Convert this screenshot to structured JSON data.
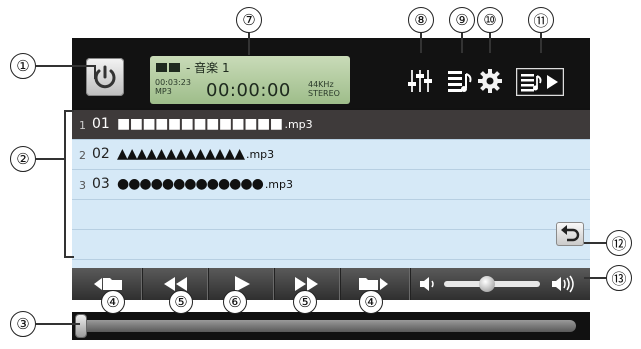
{
  "lcd": {
    "track_title": "- 音楽 1",
    "total_time": "00:03:23",
    "format": "MP3",
    "elapsed_time": "00:00:00",
    "sample_rate": "44KHz",
    "channel_mode": "STEREO"
  },
  "playlist": {
    "rows": [
      {
        "index": "1",
        "number": "01",
        "name": "■■■■■■■■■■■■■",
        "ext": ".mp3",
        "selected": true
      },
      {
        "index": "2",
        "number": "02",
        "name": "▲▲▲▲▲▲▲▲▲▲▲▲▲",
        "ext": ".mp3",
        "selected": false
      },
      {
        "index": "3",
        "number": "03",
        "name": "●●●●●●●●●●●●●",
        "ext": ".mp3",
        "selected": false
      }
    ]
  },
  "callouts": {
    "c1": "①",
    "c2": "②",
    "c3": "③",
    "c4a": "④",
    "c4b": "④",
    "c5a": "⑤",
    "c5b": "⑤",
    "c6": "⑥",
    "c7": "⑦",
    "c8": "⑧",
    "c9": "⑨",
    "c10": "⑩",
    "c11": "⑪",
    "c12": "⑫",
    "c13": "⑬"
  },
  "icons": {
    "power": "power-icon",
    "equalizer": "equalizer-icon",
    "playlist": "playlist-icon",
    "settings": "gear-icon",
    "playlist_play": "playlist-play-icon",
    "back": "return-icon",
    "prev_folder": "previous-folder-icon",
    "rewind": "rewind-icon",
    "play": "play-icon",
    "fast_forward": "fast-forward-icon",
    "next_folder": "next-folder-icon",
    "volume_low": "volume-low-icon",
    "volume_high": "volume-high-icon"
  },
  "volume": {
    "level": 0.45
  },
  "seek": {
    "position": 0.0
  },
  "colors": {
    "lcd_bg": "#a9c497",
    "list_bg": "#d6e9f7",
    "selected_row": "#3e3a3a",
    "control_bar": "#3f3f3f"
  }
}
